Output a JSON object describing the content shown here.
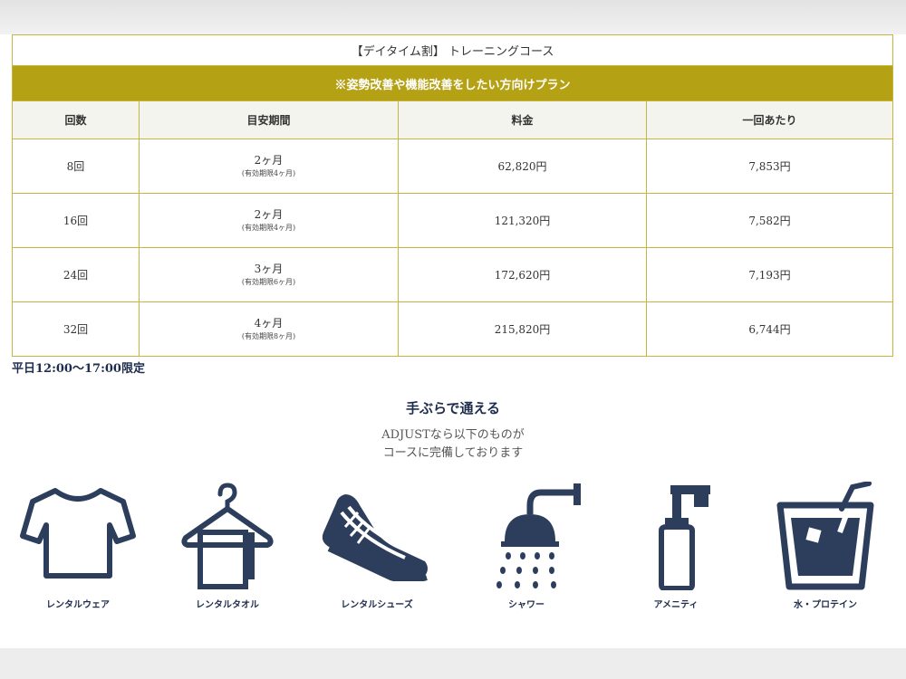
{
  "plan": {
    "title": "【デイタイム割】 トレーニングコース",
    "subtitle": "※姿勢改善や機能改善をしたい方向けプラン",
    "headers": [
      "回数",
      "目安期間",
      "料金",
      "一回あたり"
    ],
    "rows": [
      {
        "count": "8回",
        "period": "2ヶ月",
        "validity": "(有効期限4ヶ月)",
        "price": "62,820円",
        "per": "7,853円"
      },
      {
        "count": "16回",
        "period": "2ヶ月",
        "validity": "(有効期限4ヶ月)",
        "price": "121,320円",
        "per": "7,582円"
      },
      {
        "count": "24回",
        "period": "3ヶ月",
        "validity": "(有効期限6ヶ月)",
        "price": "172,620円",
        "per": "7,193円"
      },
      {
        "count": "32回",
        "period": "4ヶ月",
        "validity": "(有効期限8ヶ月)",
        "price": "215,820円",
        "per": "6,744円"
      }
    ],
    "note": "平日12:00〜17:00限定"
  },
  "amenities": {
    "title": "手ぶらで通える",
    "lead_line1": "ADJUSTなら以下のものが",
    "lead_line2": "コースに完備しております",
    "items": [
      {
        "label": "レンタルウェア",
        "icon": "tshirt-icon"
      },
      {
        "label": "レンタルタオル",
        "icon": "towel-hanger-icon"
      },
      {
        "label": "レンタルシューズ",
        "icon": "sneaker-icon"
      },
      {
        "label": "シャワー",
        "icon": "shower-icon"
      },
      {
        "label": "アメニティ",
        "icon": "pump-bottle-icon"
      },
      {
        "label": "水・プロテイン",
        "icon": "drink-cup-icon"
      }
    ]
  },
  "colors": {
    "gold": "#b5a114",
    "border": "#c9b440",
    "navy": "#2c3e5c"
  }
}
